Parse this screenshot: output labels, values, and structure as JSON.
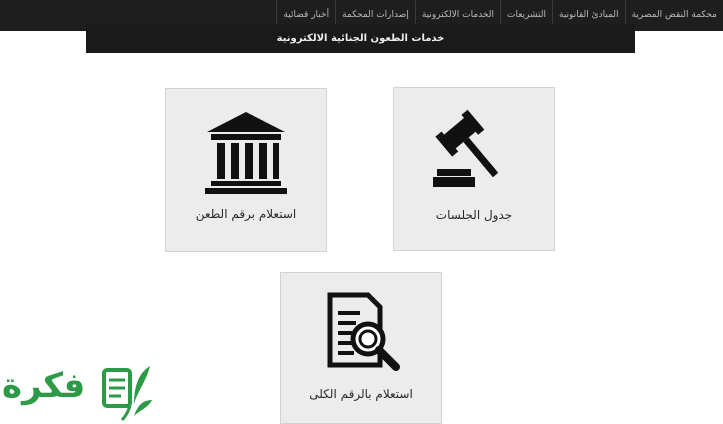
{
  "nav": {
    "items": [
      "محكمة النقض المصرية",
      "المبادئ القانونية",
      "التشريعات",
      "الخدمات الالكترونية",
      "إصدارات المحكمة",
      "أخبار قضائية"
    ]
  },
  "subbar": {
    "title": "خدمات الطعون الجنائية الالكترونية"
  },
  "cards": {
    "sessions": {
      "label": "جدول الجلسات",
      "icon": "gavel-icon"
    },
    "appeal_number": {
      "label": "استعلام برقم الطعن",
      "icon": "courthouse-icon"
    },
    "total_number": {
      "label": "استعلام بالرقم الكلى",
      "icon": "document-search-icon"
    }
  },
  "watermark": {
    "text": "فكرة",
    "color": "#2c9a46"
  }
}
